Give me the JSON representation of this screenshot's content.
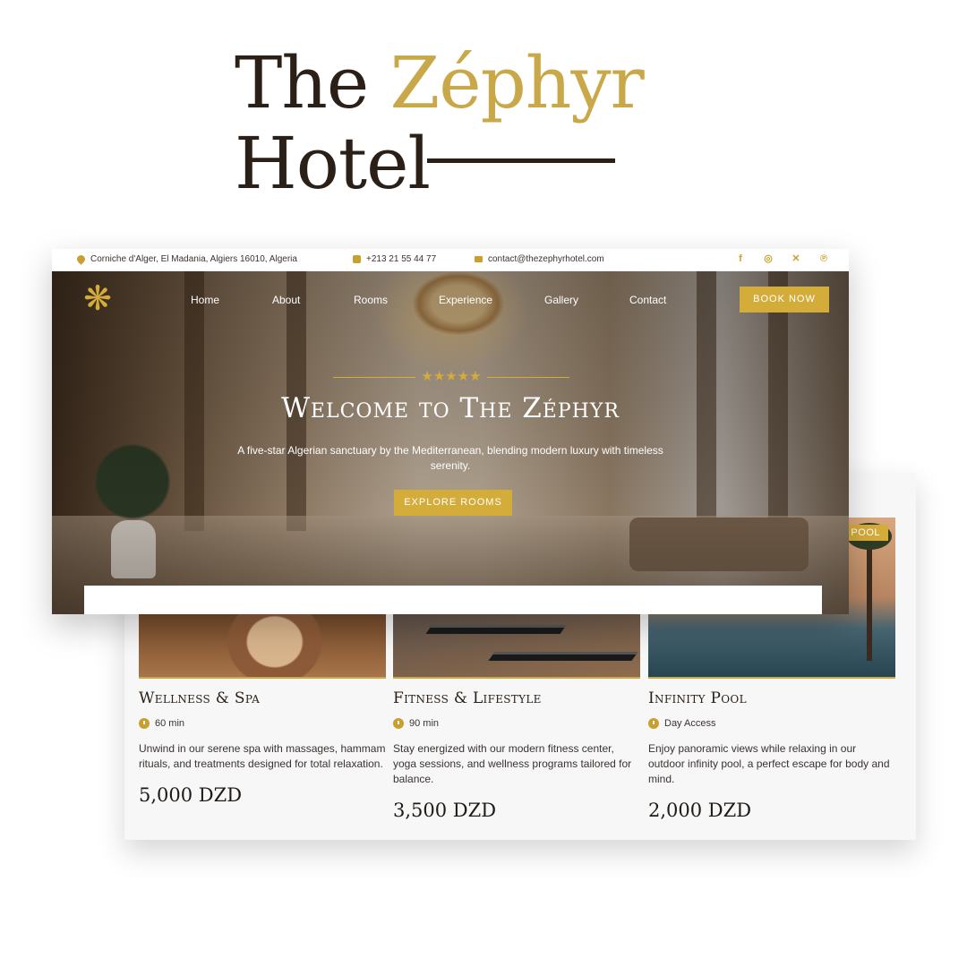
{
  "header": {
    "title_part1": "The",
    "title_accent": "Zéphyr",
    "title_line2": "Hotel"
  },
  "topbar": {
    "address": "Corniche d'Alger, El Madania, Algiers 16010, Algeria",
    "phone": "+213 21 55 44 77",
    "email": "contact@thezephyrhotel.com",
    "social": [
      "facebook-icon",
      "instagram-icon",
      "x-icon",
      "pinterest-icon"
    ]
  },
  "nav": {
    "items": [
      "Home",
      "About",
      "Rooms",
      "Experience",
      "Gallery",
      "Contact"
    ],
    "book_label": "BOOK NOW"
  },
  "hero": {
    "rating": 5,
    "title": "Welcome to The Zéphyr",
    "subtitle": "A five-star Algerian sanctuary by the Mediterranean, blending modern luxury with timeless serenity.",
    "cta": "EXPLORE ROOMS"
  },
  "services": [
    {
      "name": "Wellness & Spa",
      "duration": "60 min",
      "description": "Unwind in our serene spa with massages, hammam rituals, and treatments designed for total relaxation.",
      "price": "5,000 DZD"
    },
    {
      "name": "Fitness & Lifestyle",
      "duration": "90 min",
      "description": "Stay energized with our modern fitness center, yoga sessions, and wellness programs tailored for balance.",
      "price": "3,500 DZD"
    },
    {
      "name": "Infinity Pool",
      "badge": "POOL",
      "duration": "Day Access",
      "description": "Enjoy panoramic views while relaxing in our outdoor infinity pool, a perfect escape for body and mind.",
      "price": "2,000 DZD"
    }
  ],
  "colors": {
    "accent": "#d4ac3a",
    "dark": "#2a2018"
  }
}
